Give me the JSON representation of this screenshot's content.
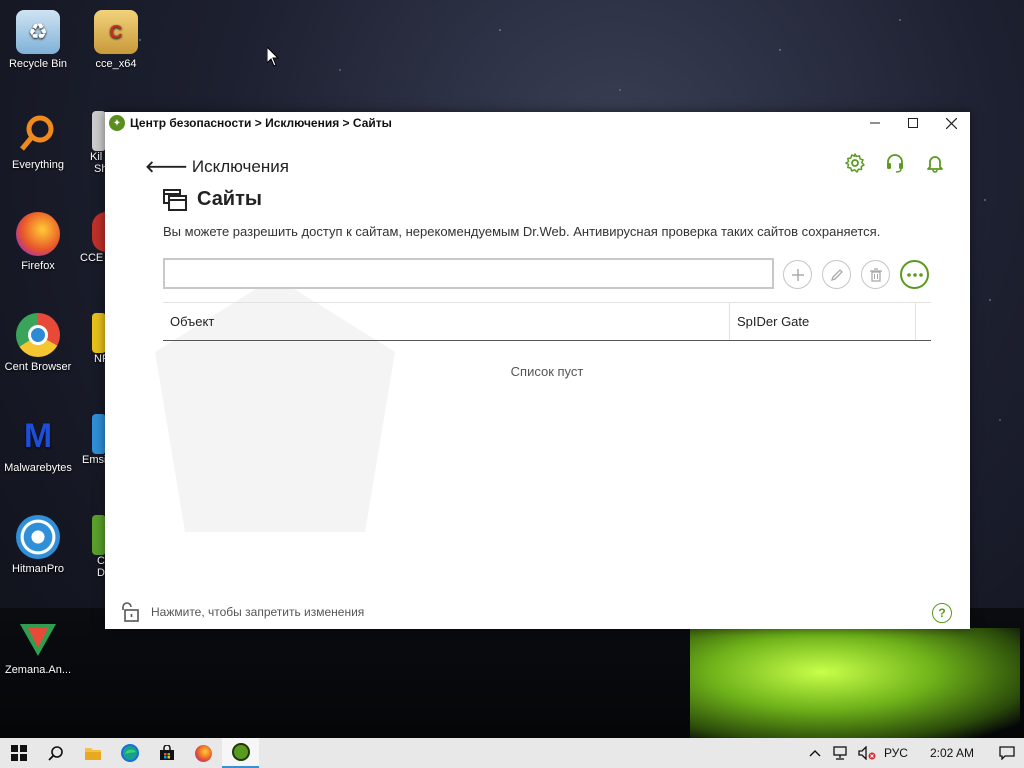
{
  "desktop": {
    "icons": [
      {
        "label": "Recycle Bin",
        "color": "#5aa0d8"
      },
      {
        "label": "cce_x64",
        "color": "#d8b45a"
      },
      {
        "label": "Everything",
        "color": "#f08a1c"
      },
      {
        "label": "Firefox",
        "color": "#e8542a"
      },
      {
        "label": "Cent Browser",
        "color": "#2d8bd6"
      },
      {
        "label": "Malwarebytes",
        "color": "#1d4ed8"
      },
      {
        "label": "HitmanPro",
        "color": "#2f8fd8"
      },
      {
        "label": "Zemana.An...",
        "color": "#2f9f4f"
      }
    ],
    "partial_labels": [
      "Kil",
      "Sh",
      "CCE",
      "NF",
      "Emsi",
      "C",
      "D"
    ]
  },
  "window": {
    "title": "Центр безопасности > Исключения > Сайты",
    "accent_color": "#5a9a1f",
    "back_label": "Исключения",
    "page_title": "Сайты",
    "description": "Вы можете разрешить доступ к сайтам, нерекомендуемым Dr.Web. Антивирусная проверка таких сайтов сохраняется.",
    "search_value": "",
    "table": {
      "columns": [
        "Объект",
        "SpIDer Gate"
      ],
      "empty_message": "Список пуст"
    },
    "footer_text": "Нажмите, чтобы запретить изменения",
    "help_label": "?"
  },
  "taskbar": {
    "language": "РУС",
    "time": "2:02 AM"
  }
}
